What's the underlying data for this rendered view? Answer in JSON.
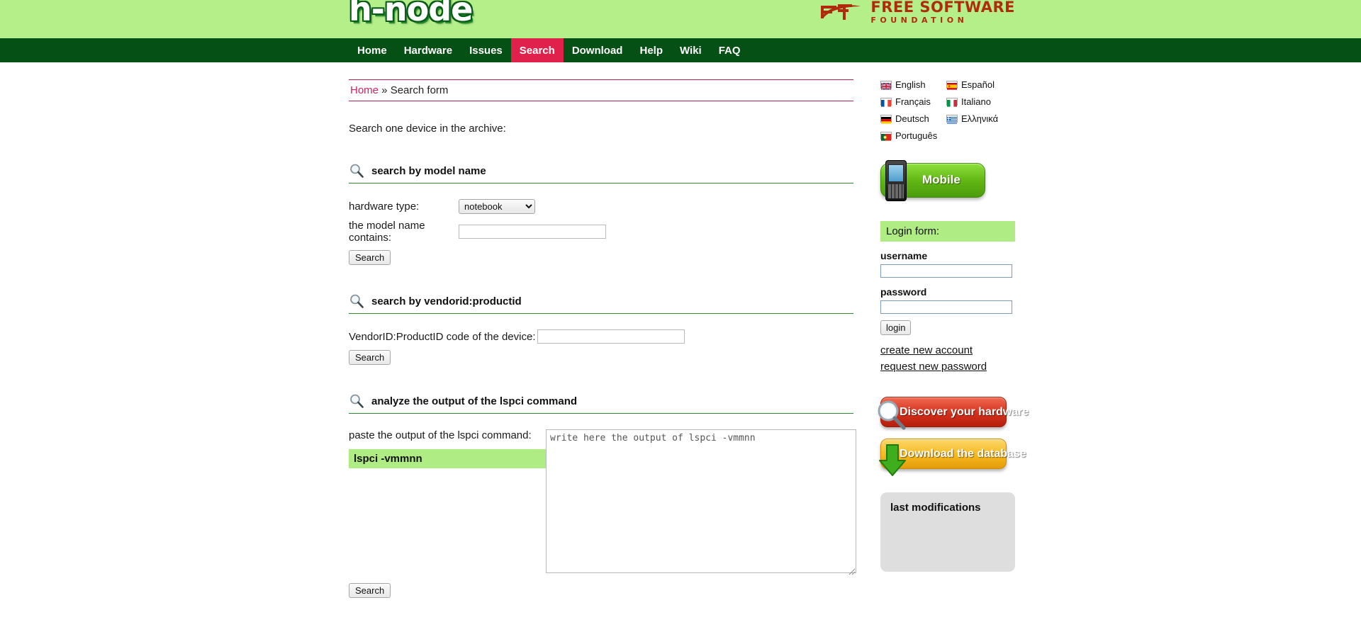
{
  "header": {
    "logo_text": "h-node",
    "fsf_line1": "FREE SOFTWARE",
    "fsf_line2": "FOUNDATION"
  },
  "nav": {
    "items": [
      {
        "label": "Home",
        "active": false
      },
      {
        "label": "Hardware",
        "active": false
      },
      {
        "label": "Issues",
        "active": false
      },
      {
        "label": "Search",
        "active": true
      },
      {
        "label": "Download",
        "active": false
      },
      {
        "label": "Help",
        "active": false
      },
      {
        "label": "Wiki",
        "active": false
      },
      {
        "label": "FAQ",
        "active": false
      }
    ]
  },
  "breadcrumb": {
    "home": "Home",
    "separator": " » ",
    "current": "Search form"
  },
  "main": {
    "intro": "Search one device in the archive:",
    "section_model": {
      "title": "search by model name",
      "hardware_type_label": "hardware type:",
      "hardware_type_value": "notebook",
      "hardware_type_options": [
        "notebook"
      ],
      "model_label": "the model name contains:",
      "model_value": "",
      "search_button": "Search"
    },
    "section_vendor": {
      "title": "search by vendorid:productid",
      "code_label": "VendorID:ProductID code of the device:",
      "code_value": "",
      "search_button": "Search"
    },
    "section_lspci": {
      "title": "analyze the output of the lspci command",
      "paste_label": "paste the output of the lspci command:",
      "command_hint": "lspci -vmmnn",
      "textarea_placeholder": "write here the output of lspci -vmmnn",
      "textarea_value": "",
      "search_button": "Search"
    }
  },
  "sidebar": {
    "languages": [
      {
        "label": "English",
        "icon": "flag-uk-icon"
      },
      {
        "label": "Español",
        "icon": "flag-spain-icon"
      },
      {
        "label": "Français",
        "icon": "flag-france-icon"
      },
      {
        "label": "Italiano",
        "icon": "flag-italy-icon"
      },
      {
        "label": "Deutsch",
        "icon": "flag-germany-icon"
      },
      {
        "label": "Ελληνικά",
        "icon": "flag-greece-icon"
      },
      {
        "label": "Português",
        "icon": "flag-portugal-icon"
      }
    ],
    "mobile_button": "Mobile",
    "login": {
      "title": "Login form:",
      "username_label": "username",
      "username_value": "",
      "password_label": "password",
      "password_value": "",
      "login_button": "login",
      "create_account": "create new account",
      "request_password": "request new password"
    },
    "cta_discover": "Discover your hardware",
    "cta_download": "Download the database",
    "last_modifications_title": "last modifications"
  },
  "colors": {
    "header_green": "#b5ef8a",
    "nav_dark_green": "#055015",
    "active_crimson": "#e0214b",
    "breadcrumb_border": "#b02050",
    "section_rule": "#2e8b33",
    "highlight_green": "#b0ec84",
    "fsf_red": "#b02b0d"
  }
}
